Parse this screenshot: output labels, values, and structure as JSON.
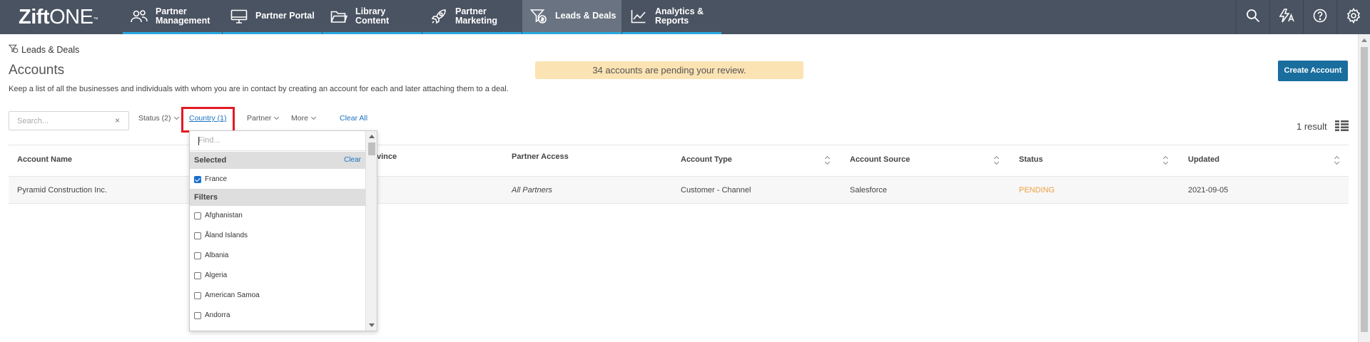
{
  "brand": {
    "logo_bold": "Zift",
    "logo_light": "ONE"
  },
  "nav": {
    "tabs": [
      {
        "label": "Partner Management",
        "icon": "partners-icon",
        "active": false
      },
      {
        "label": "Partner Portal",
        "icon": "monitor-icon",
        "active": false
      },
      {
        "label": "Library Content",
        "icon": "folder-icon",
        "active": false
      },
      {
        "label": "Partner Marketing",
        "icon": "rocket-icon",
        "active": false
      },
      {
        "label": "Leads & Deals",
        "icon": "funnel-dollar-icon",
        "active": true
      },
      {
        "label": "Analytics & Reports",
        "icon": "line-chart-icon",
        "active": false
      }
    ],
    "right_icons": [
      "search-icon",
      "translate-icon",
      "help-icon",
      "settings-icon"
    ]
  },
  "breadcrumb": {
    "label": "Leads & Deals",
    "icon": "funnel-dollar-icon"
  },
  "page": {
    "title": "Accounts",
    "description": "Keep a list of all the businesses and individuals with whom you are in contact by creating an account for each and later attaching them to a deal.",
    "pending_notice": "34 accounts are pending your review.",
    "create_button": "Create Account"
  },
  "filters": {
    "search_placeholder": "Search...",
    "search_clear": "×",
    "status": "Status (2)",
    "country": "Country (1)",
    "partner": "Partner",
    "more": "More",
    "clear_all": "Clear All",
    "result_count": "1 result"
  },
  "table": {
    "headers": {
      "account_name": "Account Name",
      "province": "vince",
      "partner_access": "Partner Access",
      "account_type": "Account Type",
      "account_source": "Account Source",
      "status": "Status",
      "updated": "Updated"
    },
    "rows": [
      {
        "account_name": "Pyramid Construction Inc.",
        "partner_access": "All Partners",
        "account_type": "Customer - Channel",
        "account_source": "Salesforce",
        "status": "PENDING",
        "updated": "2021-09-05"
      }
    ]
  },
  "country_dropdown": {
    "find_placeholder": "Find...",
    "selected_header": "Selected",
    "clear_label": "Clear",
    "selected": [
      {
        "label": "France",
        "checked": true
      }
    ],
    "filters_header": "Filters",
    "options": [
      {
        "label": "Afghanistan",
        "checked": false
      },
      {
        "label": "Åland Islands",
        "checked": false
      },
      {
        "label": "Albania",
        "checked": false
      },
      {
        "label": "Algeria",
        "checked": false
      },
      {
        "label": "American Samoa",
        "checked": false
      },
      {
        "label": "Andorra",
        "checked": false
      }
    ]
  },
  "colors": {
    "nav_bg": "#4a5361",
    "nav_active": "#6a7381",
    "nav_accent": "#29a8e0",
    "primary_button": "#1a6e9e",
    "link": "#1a73c0",
    "pending_bg": "#fbe3b3",
    "status_pending": "#f0a040",
    "highlight_box": "#e21b22"
  }
}
